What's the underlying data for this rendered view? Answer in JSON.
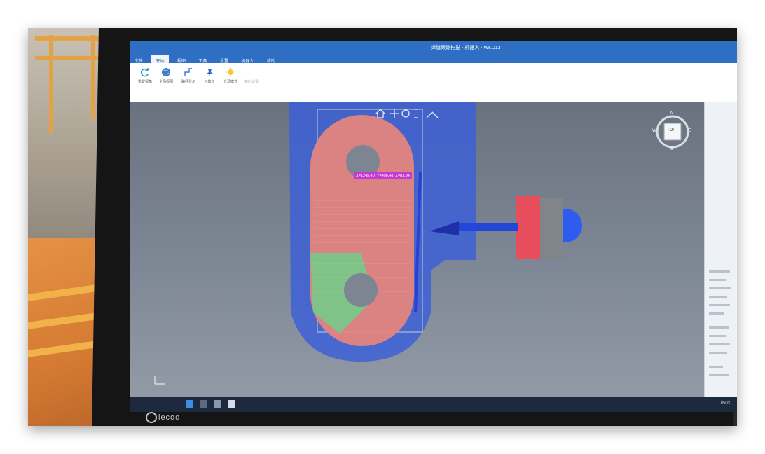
{
  "window": {
    "title": "焊缝跟踪扫描 - 机器人 - WKD13"
  },
  "menu_tabs": [
    "文件",
    "开始",
    "视图",
    "工具",
    "设置",
    "机器人",
    "帮助"
  ],
  "active_tab_index": 1,
  "ribbon": {
    "buttons": [
      {
        "label": "重置视角",
        "icon": "refresh-icon"
      },
      {
        "label": "全局视图",
        "icon": "globe-icon"
      },
      {
        "label": "路径显示",
        "icon": "path-icon"
      },
      {
        "label": "示教点",
        "icon": "pin-icon"
      },
      {
        "label": "光源模式",
        "icon": "light-icon"
      },
      {
        "label": "窗口设置",
        "icon": "settings-icon"
      }
    ]
  },
  "viewport": {
    "coordinate_readout": "X=1245.40, Y=406.48, Z=81.94",
    "view_cube_label": "TOP",
    "compass": [
      "N",
      "E",
      "S",
      "W"
    ],
    "axis_label": "L"
  },
  "taskbar": {
    "right_text": "8503"
  },
  "monitor": {
    "brand": "lecoo"
  },
  "colors": {
    "blue_overlay": "#3b5fd9",
    "scan_red": "#e8847c",
    "scan_green": "#6fcf8a",
    "tool_red": "#e84d5c",
    "tool_gray": "#7f8588",
    "readout_bg": "#c43bd0"
  }
}
